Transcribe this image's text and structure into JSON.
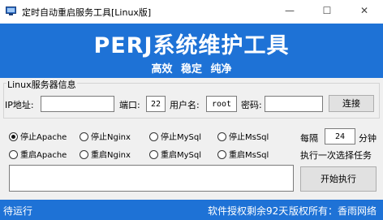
{
  "window": {
    "title": "定时自动重启服务工具[Linux版]",
    "minimize_glyph": "—",
    "maximize_glyph": "☐",
    "close_glyph": "✕"
  },
  "banner": {
    "title": "PERJ系统维护工具",
    "subtitle": "高效 稳定 纯净"
  },
  "server": {
    "legend": "Linux服务器信息",
    "ip_label": "IP地址:",
    "ip_value": "",
    "port_label": "端口:",
    "port_value": "22",
    "user_label": "用户名:",
    "user_value": "root",
    "password_label": "密码:",
    "password_value": "",
    "connect_label": "连接"
  },
  "actions": {
    "stop_apache": "停止Apache",
    "stop_nginx": "停止Nginx",
    "stop_mysql": "停止MySql",
    "stop_mssql": "停止MsSql",
    "restart_apache": "重启Apache",
    "restart_nginx": "重启Nginx",
    "restart_mysql": "重启MySql",
    "restart_mssql": "重启MsSql",
    "selected": "stop_apache"
  },
  "schedule": {
    "every_label": "每隔",
    "interval_value": "24",
    "unit_label": "分钟",
    "note": "执行一次选择任务",
    "start_label": "开始执行"
  },
  "log": {
    "content": ""
  },
  "status": {
    "state": "待运行",
    "license": "软件授权剩余92天",
    "copyright": "版权所有：香雨网络"
  },
  "colors": {
    "banner_bg": "#1e72d6",
    "status_bg": "#1e72d6"
  },
  "icons": {
    "app": "app-window-icon"
  }
}
